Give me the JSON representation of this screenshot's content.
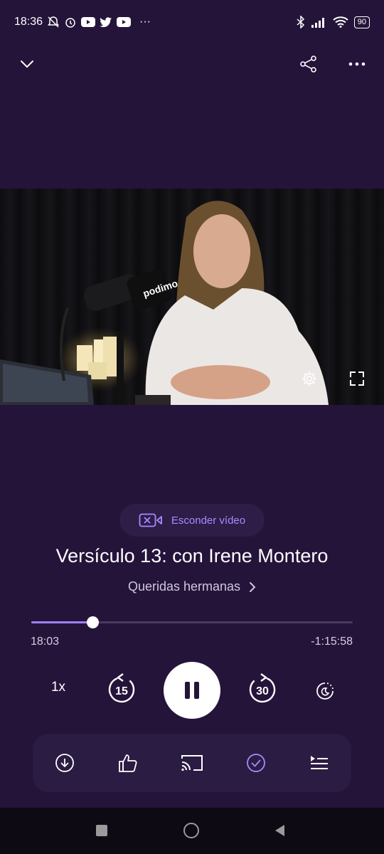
{
  "status_bar": {
    "time": "18:36",
    "more": "···",
    "battery": "90"
  },
  "top_bar": {
    "collapse_icon": "chevron-down-icon",
    "share_icon": "share-icon",
    "more_icon": "more-horizontal-icon"
  },
  "video": {
    "mic_brand": "podimo",
    "settings_icon": "gear-icon",
    "fullscreen_icon": "fullscreen-icon"
  },
  "player": {
    "hide_video_label": "Esconder vídeo",
    "episode_title": "Versículo 13: con Irene Montero",
    "show_name": "Queridas hermanas",
    "elapsed": "18:03",
    "remaining": "-1:15:58",
    "progress_fraction": 0.19,
    "speed": "1x",
    "rewind_seconds": "15",
    "forward_seconds": "30"
  },
  "toolbar": {
    "items": [
      "download-icon",
      "like-icon",
      "cast-icon",
      "mark-played-icon",
      "queue-icon"
    ]
  },
  "colors": {
    "background": "#24143a",
    "accent": "#a88bff",
    "progress": "#9b84f0"
  }
}
